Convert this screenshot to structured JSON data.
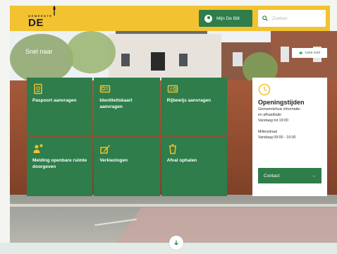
{
  "header": {
    "logo_small": "GEMEENTE",
    "logo_big": "DE BILT",
    "mijn_label": "Mijn De Bilt",
    "search_placeholder": "Zoeken"
  },
  "hero": {
    "snel_naar": "Snel naar",
    "lees_voor": "Lees voor"
  },
  "tiles": [
    {
      "label": "Paspoort aanvragen",
      "icon": "passport-icon"
    },
    {
      "label": "Identiteitskaart aanvragen",
      "icon": "id-card-icon"
    },
    {
      "label": "Rijbewijs aanvragen",
      "icon": "drivers-license-icon"
    },
    {
      "label": "Melding openbare ruimte doorgeven",
      "icon": "report-icon"
    },
    {
      "label": "Verkiezingen",
      "icon": "vote-icon"
    },
    {
      "label": "Afval ophalen",
      "icon": "waste-bin-icon"
    }
  ],
  "hours": {
    "title": "Openingstijden",
    "line1": "Gemeentehuis informatie-",
    "line2": "en afhaalbalie",
    "line3": "Vandaag tot 19:00",
    "line4": "Milieustraat",
    "line5": "Vandaag 09:00 - 16:00",
    "contact_label": "Contact",
    "contact_arrow": "→"
  },
  "colors": {
    "accent_yellow": "#f2c230",
    "brand_green": "#2e7d4b"
  }
}
